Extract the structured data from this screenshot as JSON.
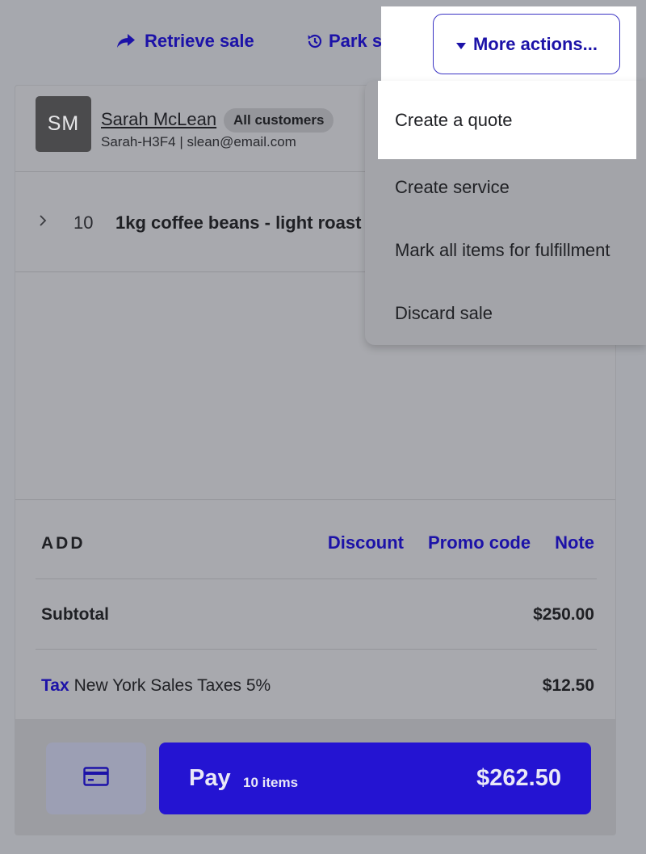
{
  "topbar": {
    "retrieve_label": "Retrieve sale",
    "park_label": "Park sale",
    "more_label": "More actions..."
  },
  "customer": {
    "initials": "SM",
    "name": "Sarah McLean",
    "group": "All customers",
    "details": "Sarah-H3F4 | slean@email.com"
  },
  "line_items": [
    {
      "quantity": "10",
      "name": "1kg coffee beans - light roast"
    }
  ],
  "add": {
    "label": "ADD",
    "discount": "Discount",
    "promo": "Promo code",
    "note": "Note"
  },
  "totals": {
    "subtotal_label": "Subtotal",
    "subtotal_value": "$250.00",
    "tax_link": "Tax",
    "tax_name": "New York Sales Taxes 5%",
    "tax_value": "$12.50"
  },
  "pay": {
    "label": "Pay",
    "items": "10 items",
    "total": "$262.50"
  },
  "dropdown": {
    "items": [
      {
        "label": "Create a quote"
      },
      {
        "label": "Create service"
      },
      {
        "label": "Mark all items for fulfillment"
      },
      {
        "label": "Discard sale"
      }
    ]
  },
  "colors": {
    "accent": "#1c12a8",
    "pay_button": "#2414d2",
    "backdrop": "#a6a8ae"
  }
}
